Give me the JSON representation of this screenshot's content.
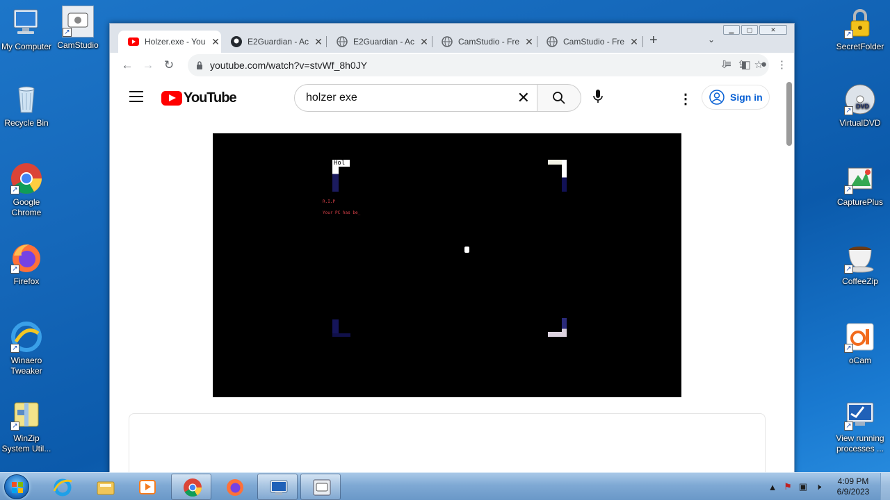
{
  "desktop": {
    "left_icons": [
      {
        "label": "My Computer"
      },
      {
        "label": "CamStudio"
      },
      {
        "label": "Recycle Bin"
      },
      {
        "label": "Google Chrome"
      },
      {
        "label": "Firefox"
      },
      {
        "label": "Winaero Tweaker"
      },
      {
        "label": "WinZip System Util..."
      }
    ],
    "right_icons": [
      {
        "label": "SecretFolder"
      },
      {
        "label": "VirtualDVD"
      },
      {
        "label": "CapturePlus"
      },
      {
        "label": "CoffeeZip"
      },
      {
        "label": "oCam"
      },
      {
        "label": "View running processes ..."
      }
    ]
  },
  "browser": {
    "tabs": [
      {
        "title": "Holzer.exe - You",
        "icon": "youtube-icon",
        "active": true
      },
      {
        "title": "E2Guardian - Ac",
        "icon": "github-icon",
        "active": false
      },
      {
        "title": "E2Guardian - Ac",
        "icon": "globe-icon",
        "active": false
      },
      {
        "title": "CamStudio - Fre",
        "icon": "globe-icon",
        "active": false
      },
      {
        "title": "CamStudio - Fre",
        "icon": "globe-icon",
        "active": false
      }
    ],
    "url": "youtube.com/watch?v=stvWf_8h0JY"
  },
  "youtube": {
    "logo_text": "YouTube",
    "search_query": "holzer exe",
    "sign_in_label": "Sign in"
  },
  "video": {
    "overlay_title": "Hol",
    "rip_line": "R.I.P",
    "pc_line": "Your PC has be_"
  },
  "taskbar": {
    "time": "4:09 PM",
    "date": "6/9/2023"
  },
  "colors": {
    "youtube_red": "#ff0000",
    "link_blue": "#065fd4",
    "desktop_blue": "#1466b8"
  }
}
